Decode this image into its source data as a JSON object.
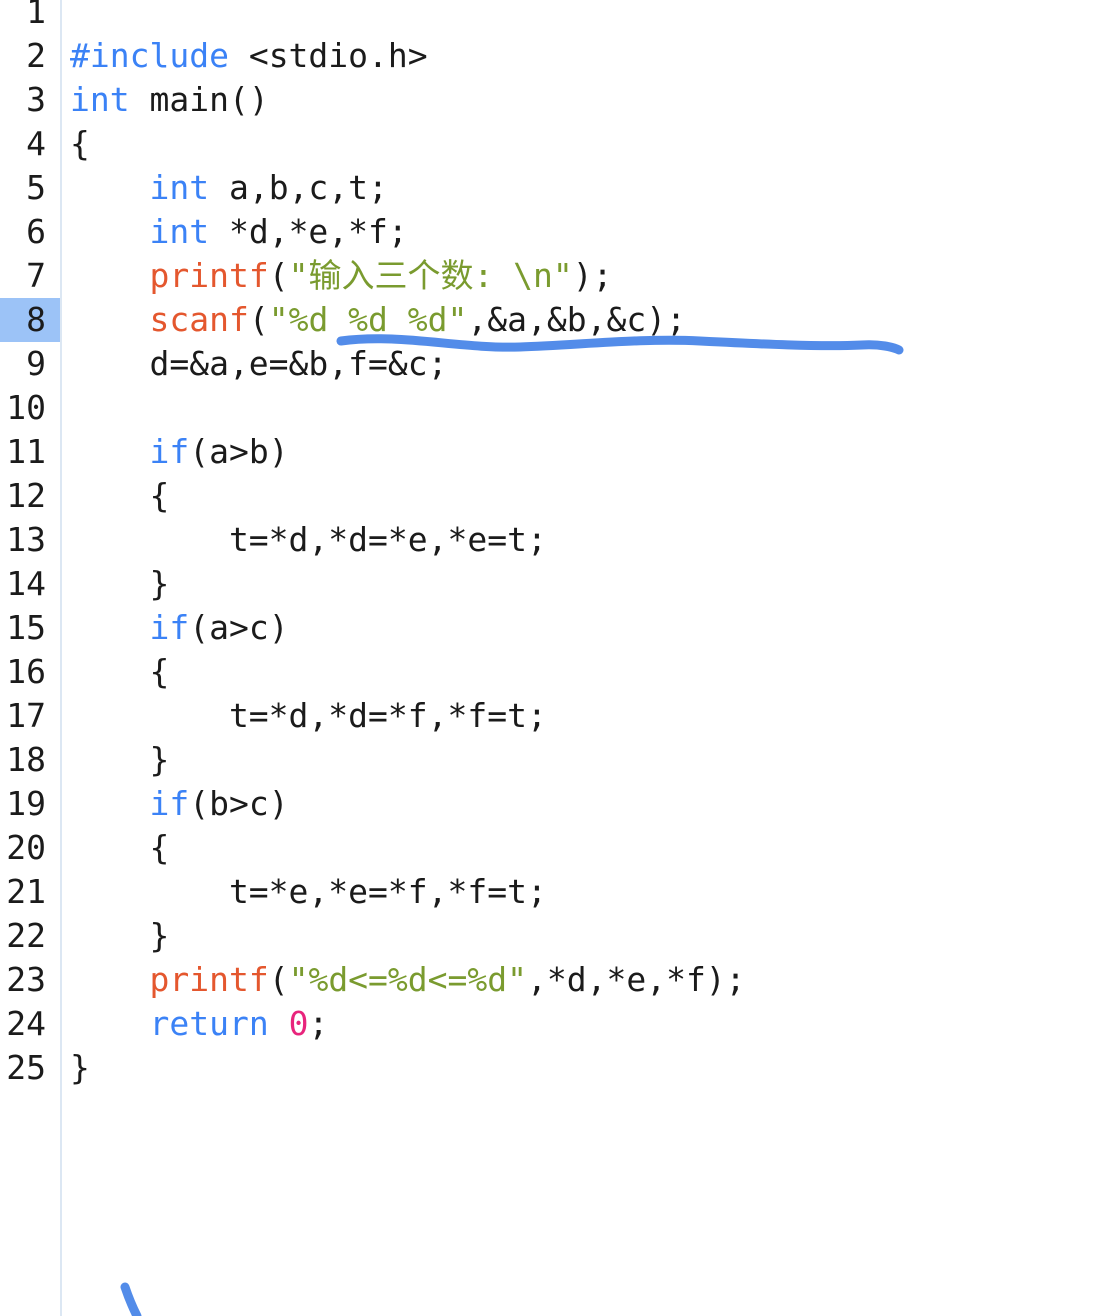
{
  "editor": {
    "name": "c-source-code-editor",
    "language": "C",
    "active_line": 8,
    "total_lines_shown": 25,
    "colors": {
      "background": "#ffffff",
      "gutter_divider": "#dce7f3",
      "active_line_highlight": "#9cc3f7",
      "keyword": "#3b82f6",
      "function": "#e4572e",
      "string": "#7a9b2f",
      "number": "#e8247c",
      "plain_text": "#1b1b1b",
      "annotation_ink": "#4a86e8"
    }
  },
  "lines": [
    {
      "number": "1",
      "tokens": []
    },
    {
      "number": "2",
      "tokens": [
        {
          "t": "#include",
          "c": "kw"
        },
        {
          "t": " <stdio.h>",
          "c": "plain"
        }
      ]
    },
    {
      "number": "3",
      "tokens": [
        {
          "t": "int",
          "c": "kw"
        },
        {
          "t": " main()",
          "c": "plain"
        }
      ]
    },
    {
      "number": "4",
      "tokens": [
        {
          "t": "{",
          "c": "plain"
        }
      ]
    },
    {
      "number": "5",
      "tokens": [
        {
          "t": "    ",
          "c": "plain"
        },
        {
          "t": "int",
          "c": "kw"
        },
        {
          "t": " a,b,c,t;",
          "c": "plain"
        }
      ]
    },
    {
      "number": "6",
      "tokens": [
        {
          "t": "    ",
          "c": "plain"
        },
        {
          "t": "int",
          "c": "kw"
        },
        {
          "t": " *d,*e,*f;",
          "c": "plain"
        }
      ]
    },
    {
      "number": "7",
      "tokens": [
        {
          "t": "    ",
          "c": "plain"
        },
        {
          "t": "printf",
          "c": "fn"
        },
        {
          "t": "(",
          "c": "plain"
        },
        {
          "t": "\"输入三个数: \\n\"",
          "c": "str"
        },
        {
          "t": ");",
          "c": "plain"
        }
      ]
    },
    {
      "number": "8",
      "tokens": [
        {
          "t": "    ",
          "c": "plain"
        },
        {
          "t": "scanf",
          "c": "fn"
        },
        {
          "t": "(",
          "c": "plain"
        },
        {
          "t": "\"%d %d %d\"",
          "c": "str"
        },
        {
          "t": ",&a,&b,&c);",
          "c": "plain"
        }
      ]
    },
    {
      "number": "9",
      "tokens": [
        {
          "t": "    d=&a,e=&b,f=&c;",
          "c": "plain"
        }
      ]
    },
    {
      "number": "10",
      "tokens": []
    },
    {
      "number": "11",
      "tokens": [
        {
          "t": "    ",
          "c": "plain"
        },
        {
          "t": "if",
          "c": "kw"
        },
        {
          "t": "(a>b)",
          "c": "plain"
        }
      ]
    },
    {
      "number": "12",
      "tokens": [
        {
          "t": "    {",
          "c": "plain"
        }
      ]
    },
    {
      "number": "13",
      "tokens": [
        {
          "t": "        t=*d,*d=*e,*e=t;",
          "c": "plain"
        }
      ]
    },
    {
      "number": "14",
      "tokens": [
        {
          "t": "    }",
          "c": "plain"
        }
      ]
    },
    {
      "number": "15",
      "tokens": [
        {
          "t": "    ",
          "c": "plain"
        },
        {
          "t": "if",
          "c": "kw"
        },
        {
          "t": "(a>c)",
          "c": "plain"
        }
      ]
    },
    {
      "number": "16",
      "tokens": [
        {
          "t": "    {",
          "c": "plain"
        }
      ]
    },
    {
      "number": "17",
      "tokens": [
        {
          "t": "        t=*d,*d=*f,*f=t;",
          "c": "plain"
        }
      ]
    },
    {
      "number": "18",
      "tokens": [
        {
          "t": "    }",
          "c": "plain"
        }
      ]
    },
    {
      "number": "19",
      "tokens": [
        {
          "t": "    ",
          "c": "plain"
        },
        {
          "t": "if",
          "c": "kw"
        },
        {
          "t": "(b>c)",
          "c": "plain"
        }
      ]
    },
    {
      "number": "20",
      "tokens": [
        {
          "t": "    {",
          "c": "plain"
        }
      ]
    },
    {
      "number": "21",
      "tokens": [
        {
          "t": "        t=*e,*e=*f,*f=t;",
          "c": "plain"
        }
      ]
    },
    {
      "number": "22",
      "tokens": [
        {
          "t": "    }",
          "c": "plain"
        }
      ]
    },
    {
      "number": "23",
      "tokens": [
        {
          "t": "    ",
          "c": "plain"
        },
        {
          "t": "printf",
          "c": "fn"
        },
        {
          "t": "(",
          "c": "plain"
        },
        {
          "t": "\"%d<=%d<=%d\"",
          "c": "str"
        },
        {
          "t": ",*d,*e,*f);",
          "c": "plain"
        }
      ]
    },
    {
      "number": "24",
      "tokens": [
        {
          "t": "    ",
          "c": "plain"
        },
        {
          "t": "return",
          "c": "kw"
        },
        {
          "t": " ",
          "c": "plain"
        },
        {
          "t": "0",
          "c": "num"
        },
        {
          "t": ";",
          "c": "plain"
        }
      ]
    },
    {
      "number": "25",
      "tokens": [
        {
          "t": "}",
          "c": "plain"
        }
      ]
    }
  ],
  "annotations": [
    {
      "name": "underline-scanf-format-string",
      "kind": "hand-drawn-underline",
      "color": "#4a86e8",
      "targets_line": "8",
      "covers_text": "\"%d %d %d\",&a,&b,&c);"
    },
    {
      "name": "stray-pen-stroke",
      "kind": "hand-drawn-stroke",
      "color": "#4a86e8",
      "targets_line": ""
    }
  ]
}
